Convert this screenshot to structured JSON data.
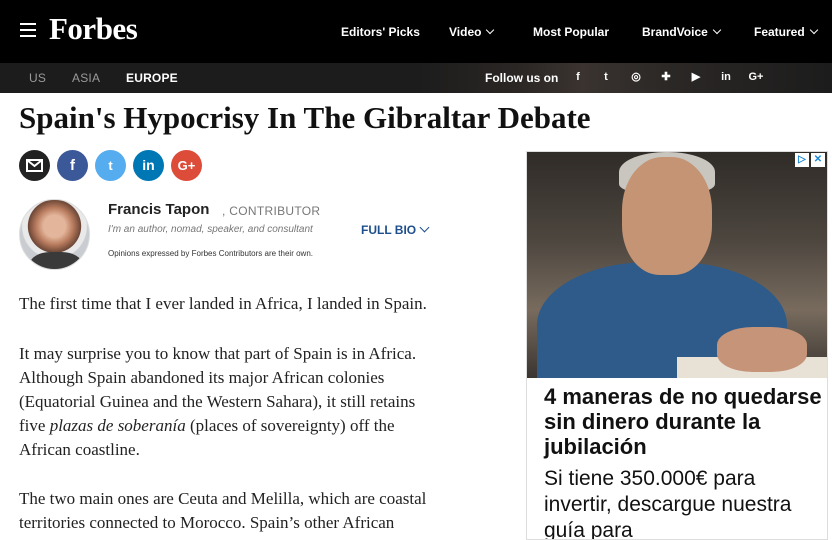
{
  "header": {
    "logo": "Forbes",
    "nav": [
      {
        "label": "Editors' Picks",
        "dropdown": false
      },
      {
        "label": "Video",
        "dropdown": true
      },
      {
        "label": "Most Popular",
        "dropdown": false
      },
      {
        "label": "BrandVoice",
        "dropdown": true
      },
      {
        "label": "Featured",
        "dropdown": true
      }
    ]
  },
  "subbar": {
    "editions": [
      "US",
      "ASIA",
      "EUROPE"
    ],
    "active_edition": "EUROPE",
    "follow_label": "Follow us on",
    "social_icons": [
      "f",
      "t",
      "◎",
      "✚",
      "▶",
      "in",
      "G+"
    ]
  },
  "article": {
    "title": "Spain's Hypocrisy In The Gibraltar Debate",
    "share_icons": [
      "email-icon",
      "facebook-icon",
      "twitter-icon",
      "linkedin-icon",
      "googleplus-icon"
    ],
    "author": {
      "name": "Francis Tapon",
      "role": "CONTRIBUTOR",
      "bio": "I'm an author, nomad, speaker, and consultant",
      "full_bio_label": "FULL BIO",
      "disclaimer": "Opinions expressed by Forbes Contributors are their own."
    },
    "paragraphs": {
      "p1": "The first time that I ever landed in Africa, I landed in Spain.",
      "p2_line1": "It may surprise you to know that part of Spain is in Africa.",
      "p2_line2": "Although Spain abandoned its major African colonies",
      "p2_line3": "(Equatorial Guinea and the Western Sahara), it still retains",
      "p2_line4_prefix": "five ",
      "p2_line4_italic": "plazas de soberanía",
      "p2_line4_suffix": " (places of sovereignty) off the",
      "p2_line5": "African coastline.",
      "p3_line1": "The two main ones are Ceuta and Melilla, which are coastal",
      "p3_line2": "territories connected to Morocco. Spain’s other African"
    }
  },
  "ad": {
    "title": "4 maneras de no quedarse sin dinero durante la jubilación",
    "text": "Si tiene 350.000€ para invertir, descargue nuestra guía para"
  },
  "colors": {
    "topbar": "#000000",
    "link_blue": "#1d4f8c",
    "email": "#222222",
    "facebook": "#3b5998",
    "twitter": "#55acee",
    "linkedin": "#0077b5",
    "googleplus": "#dd4b39"
  }
}
